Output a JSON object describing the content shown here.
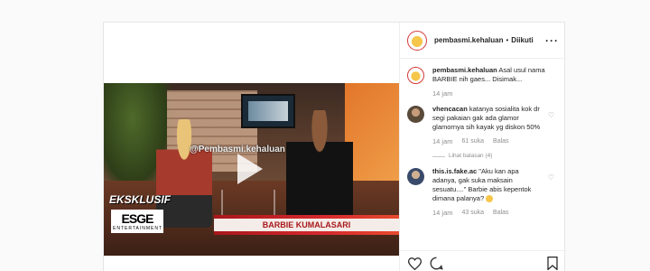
{
  "header": {
    "username": "pembasmi.kehaluan",
    "separator": "•",
    "follow_label": "Diikuti",
    "more_label": "···"
  },
  "video": {
    "watermark": "@Pembasmi.kehaluan",
    "eksklusif": "EKSKLUSIF",
    "brand": "ESGE",
    "brand_sub": "ENTERTAINMENT",
    "lower_third_name": "BARBIE KUMALASARI"
  },
  "comments": [
    {
      "username": "pembasmi.kehaluan",
      "text": "Asal usul nama BARBIE nih gaes... Disimak...",
      "time": "14 jam"
    },
    {
      "username": "vhencacan",
      "text": "katanya sosialita kok dr segi pakaian gak ada glamor glamornya sih kayak yg diskon 50%",
      "time": "14 jam",
      "likes": "61 suka",
      "reply_label": "Balas",
      "view_replies": "Lihat balasan (4)"
    },
    {
      "username": "this.is.fake.ac",
      "text": "\"Aku kan apa adanya, gak suka maksain sesuatu....\" Barbie abis kepentok dimana palanya?",
      "time": "14 jam",
      "likes": "43 suka",
      "reply_label": "Balas"
    }
  ],
  "icons": [
    "heart-icon",
    "comment-icon",
    "bookmark-icon",
    "more-icon"
  ],
  "colors": {
    "accent": "#d43a3a",
    "muted": "#8e8e8e",
    "lower_third": "#a8171b"
  }
}
